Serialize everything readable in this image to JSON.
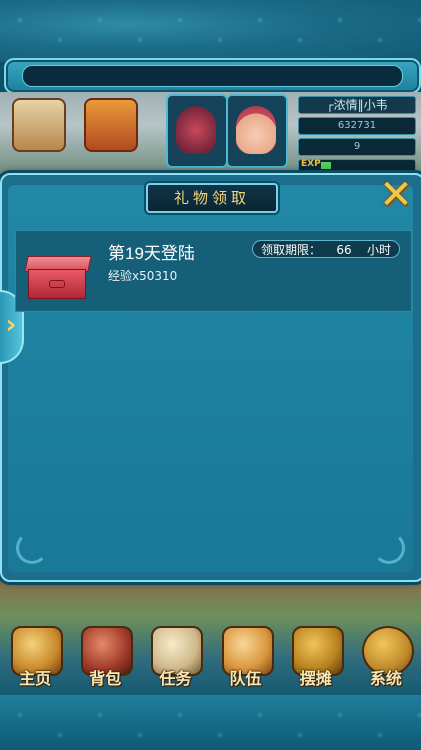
{
  "header": {
    "player_name": "┌浓情‖小韦",
    "stat_1": "632731",
    "stat_2": "9",
    "exp_label": "EXP"
  },
  "dialog": {
    "title": "礼物领取",
    "close_icon": "close-x-icon",
    "side_tab_icon": "chevron-right-icon",
    "rewards": [
      {
        "title": "第19天登陆",
        "detail": "经验x50310",
        "deadline_label": "领取期限：",
        "deadline_value": "66",
        "deadline_unit": "小时",
        "icon": "gift-box-icon"
      }
    ]
  },
  "bottom_nav": [
    {
      "label": "主页",
      "icon": "home-icon"
    },
    {
      "label": "背包",
      "icon": "backpack-icon"
    },
    {
      "label": "任务",
      "icon": "quest-scroll-icon"
    },
    {
      "label": "队伍",
      "icon": "team-icon"
    },
    {
      "label": "摆摊",
      "icon": "stall-icon"
    },
    {
      "label": "系统",
      "icon": "gear-icon"
    }
  ],
  "colors": {
    "panel": "#1b6f8c",
    "title_text": "#f4d67a",
    "close": "#f5c64a",
    "gift": "#d7505c"
  }
}
